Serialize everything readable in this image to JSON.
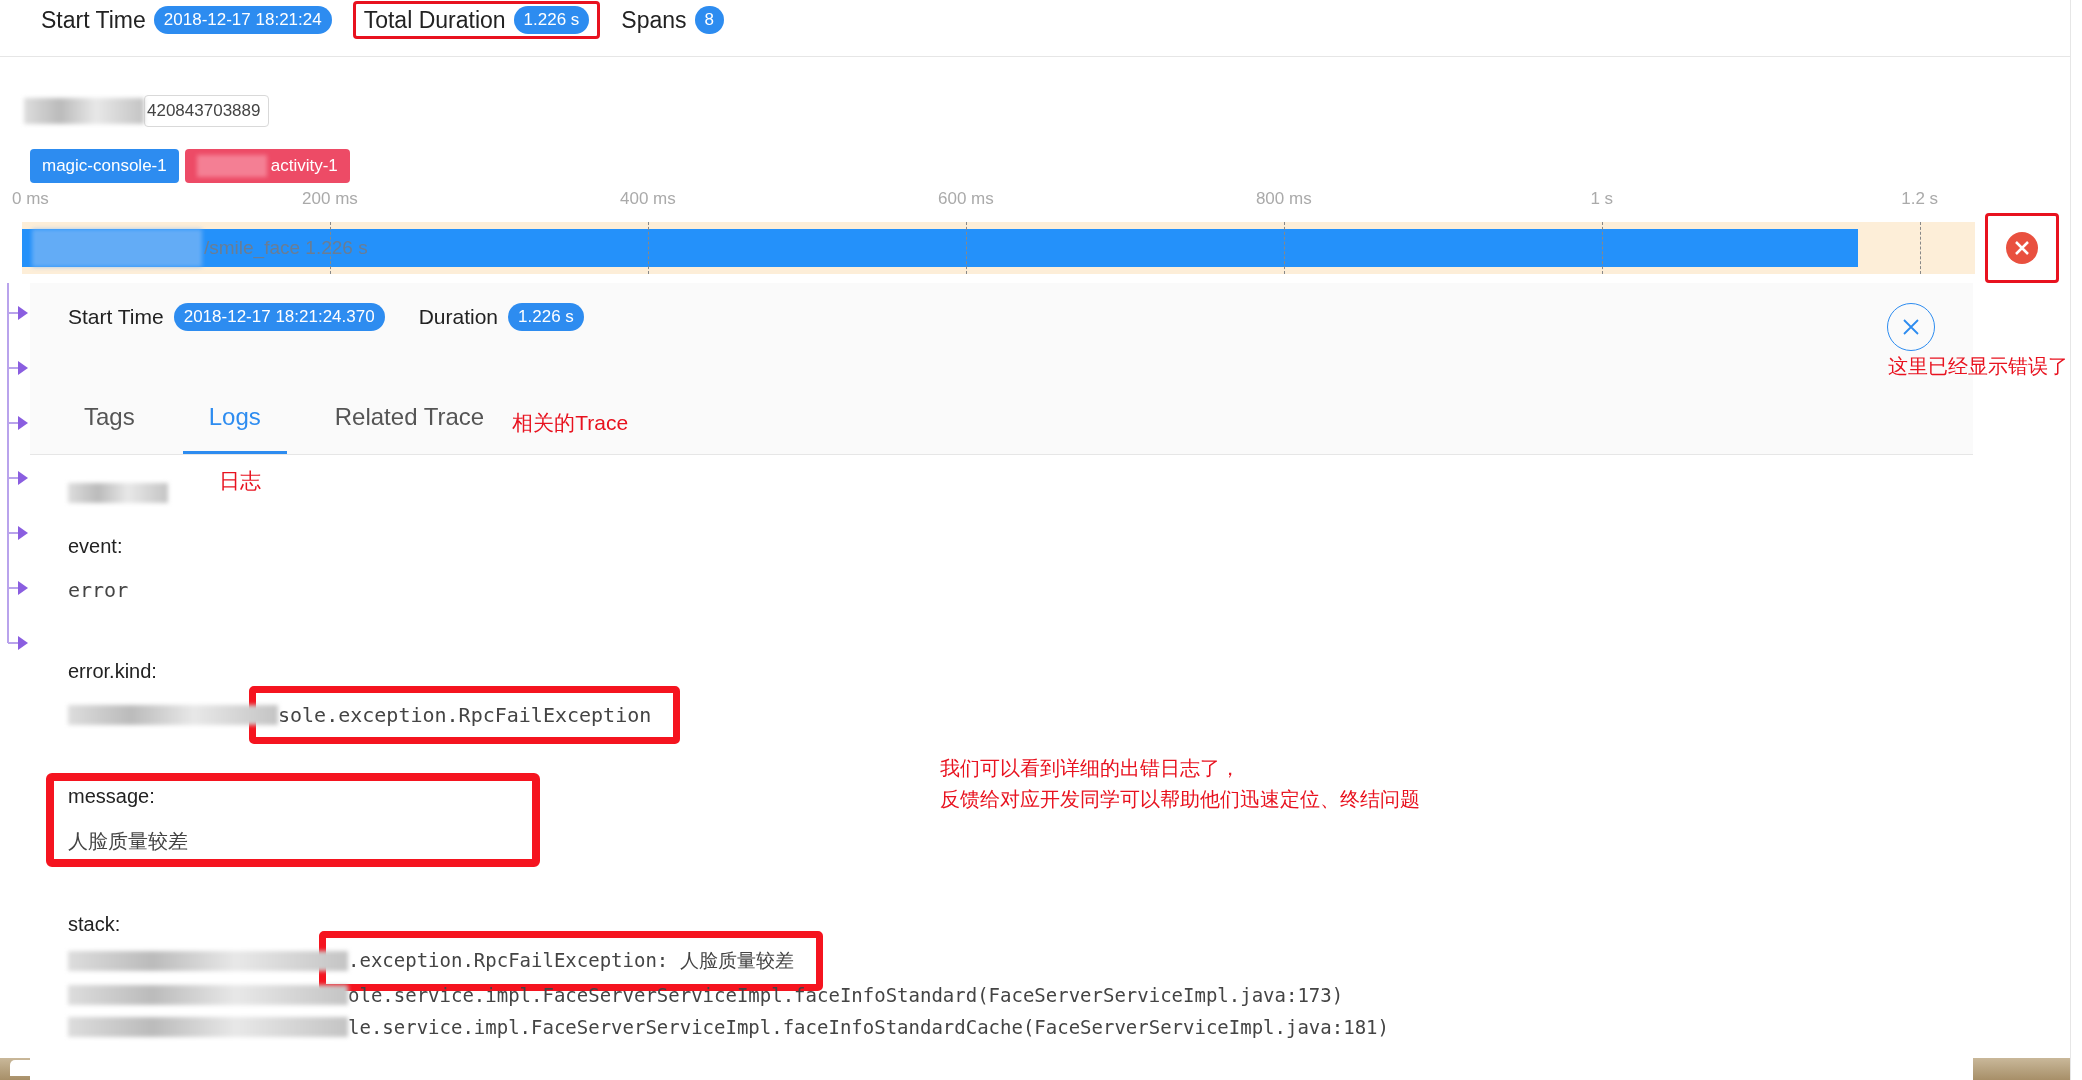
{
  "summary": [
    {
      "label": "Start Time",
      "value": "2018-12-17 18:21:24",
      "highlighted": false
    },
    {
      "label": "Total Duration",
      "value": "1.226 s",
      "highlighted": true
    },
    {
      "label": "Spans",
      "value": "8",
      "highlighted": false
    }
  ],
  "trace_id": "420843703889",
  "services": [
    {
      "name": "magic-console-1",
      "color": "#2d8cf0"
    },
    {
      "name": "activity-1",
      "color": "#ed4b66"
    }
  ],
  "axis_ticks": [
    "0 ms",
    "200 ms",
    "400 ms",
    "600 ms",
    "800 ms",
    "1 s",
    "1.2 s"
  ],
  "span": {
    "label": "/smile_face 1.226 s",
    "level": 0.94,
    "error": true,
    "highlighted": true,
    "note": "这里已经显示错误了"
  },
  "detail": {
    "start_time_label": "Start Time",
    "start_time": "2018-12-17 18:21:24.370",
    "duration_label": "Duration",
    "duration": "1.226 s",
    "tabs": [
      {
        "label": "Tags",
        "selected": false
      },
      {
        "label": "Logs",
        "selected": true,
        "note": "日志"
      },
      {
        "label": "Related Trace",
        "selected": false,
        "note": "相关的Trace"
      }
    ]
  },
  "logs": [
    {
      "key": "event:",
      "value": "error",
      "redacted": false,
      "highlighted": false,
      "value_highlighted": false
    },
    {
      "key": "error.kind:",
      "value": "sole.exception.RpcFailException",
      "redacted": true,
      "highlighted": false,
      "value_highlighted": true
    },
    {
      "key": "message:",
      "value": "人脸质量较差",
      "redacted": false,
      "highlighted": true,
      "value_highlighted": false
    }
  ],
  "logs_note": [
    "我们可以看到详细的出错日志了，",
    "反馈给对应开发同学可以帮助他们迅速定位、终结问题"
  ],
  "stack": {
    "key": "stack:",
    "lines": [
      {
        "text": ".exception.RpcFailException: 人脸质量较差",
        "highlighted": true
      },
      {
        "text": "ole.service.impl.FaceServerServiceImpl.faceInfoStandard(FaceServerServiceImpl.java:173)",
        "highlighted": false
      },
      {
        "text": "le.service.impl.FaceServerServiceImpl.faceInfoStandardCache(FaceServerServiceImpl.java:181)",
        "highlighted": false
      }
    ]
  }
}
